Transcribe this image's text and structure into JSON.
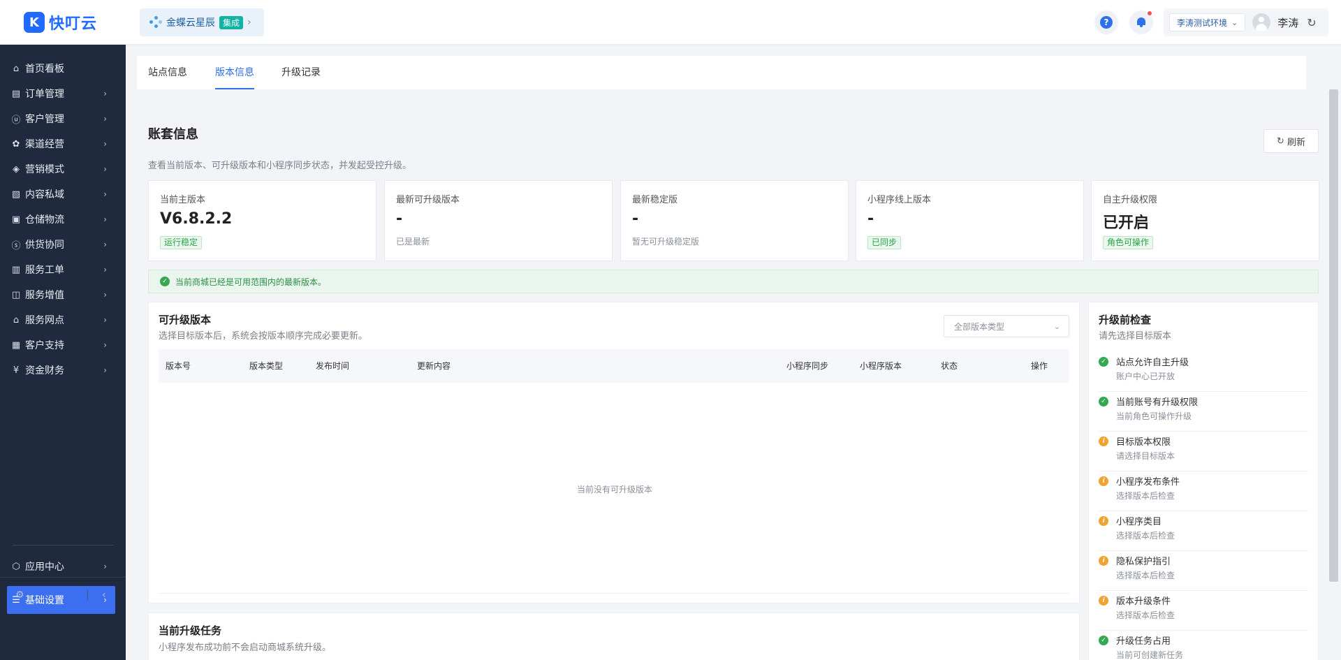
{
  "header": {
    "logo_text": "快叮云",
    "site_name": "金蝶云星辰",
    "site_tag": "集成",
    "env_label": "李涛测试环境",
    "user_name": "李涛"
  },
  "sidebar": {
    "items": [
      {
        "label": "首页看板",
        "icon": "home-icon"
      },
      {
        "label": "订单管理",
        "icon": "order-icon"
      },
      {
        "label": "客户管理",
        "icon": "user-icon"
      },
      {
        "label": "渠道经营",
        "icon": "channel-icon"
      },
      {
        "label": "营销模式",
        "icon": "tag-icon"
      },
      {
        "label": "内容私域",
        "icon": "image-icon"
      },
      {
        "label": "仓储物流",
        "icon": "warehouse-icon"
      },
      {
        "label": "供货协同",
        "icon": "supply-icon"
      },
      {
        "label": "服务工单",
        "icon": "ticket-icon"
      },
      {
        "label": "服务增值",
        "icon": "bag-icon"
      },
      {
        "label": "服务网点",
        "icon": "store-icon"
      },
      {
        "label": "客户支持",
        "icon": "support-icon"
      },
      {
        "label": "资金财务",
        "icon": "yuan-icon"
      }
    ],
    "bottom_items": [
      {
        "label": "应用中心",
        "icon": "cube-icon"
      },
      {
        "label": "基础设置",
        "icon": "settings-sliders-icon"
      }
    ]
  },
  "tabs": [
    "站点信息",
    "版本信息",
    "升级记录"
  ],
  "account": {
    "title": "账套信息",
    "desc": "查看当前版本、可升级版本和小程序同步状态，并发起受控升级。",
    "refresh_label": "刷新"
  },
  "cards": [
    {
      "label": "当前主版本",
      "value": "V6.8.2.2",
      "badge": "运行稳定"
    },
    {
      "label": "最新可升级版本",
      "value": "-",
      "sub": "已是最新"
    },
    {
      "label": "最新稳定版",
      "value": "-",
      "sub": "暂无可升级稳定版"
    },
    {
      "label": "小程序线上版本",
      "value": "-",
      "badge": "已同步"
    },
    {
      "label": "自主升级权限",
      "value": "已开启",
      "badge": "角色可操作"
    }
  ],
  "notice": "当前商城已经是可用范围内的最新版本。",
  "upgrade": {
    "title": "可升级版本",
    "desc": "选择目标版本后，系统会按版本顺序完成必要更新。",
    "filter_placeholder": "全部版本类型",
    "columns": [
      "版本号",
      "版本类型",
      "发布时间",
      "更新内容",
      "小程序同步",
      "小程序版本",
      "状态",
      "操作"
    ],
    "empty_text": "当前没有可升级版本"
  },
  "task": {
    "title": "当前升级任务",
    "desc": "小程序发布成功前不会启动商城系统升级。"
  },
  "precheck": {
    "title": "升级前检查",
    "desc": "请先选择目标版本",
    "items": [
      {
        "title": "站点允许自主升级",
        "sub": "账户中心已开放",
        "status": "ok"
      },
      {
        "title": "当前账号有升级权限",
        "sub": "当前角色可操作升级",
        "status": "ok"
      },
      {
        "title": "目标版本权限",
        "sub": "请选择目标版本",
        "status": "warn"
      },
      {
        "title": "小程序发布条件",
        "sub": "选择版本后检查",
        "status": "warn"
      },
      {
        "title": "小程序类目",
        "sub": "选择版本后检查",
        "status": "warn"
      },
      {
        "title": "隐私保护指引",
        "sub": "选择版本后检查",
        "status": "warn"
      },
      {
        "title": "版本升级条件",
        "sub": "选择版本后检查",
        "status": "warn"
      },
      {
        "title": "升级任务占用",
        "sub": "当前可创建新任务",
        "status": "ok"
      }
    ]
  },
  "colors": {
    "accent": "#2f6fe8",
    "sidebar_bg": "#1f2a3f",
    "success": "#35a853",
    "warning": "#f0a330"
  }
}
